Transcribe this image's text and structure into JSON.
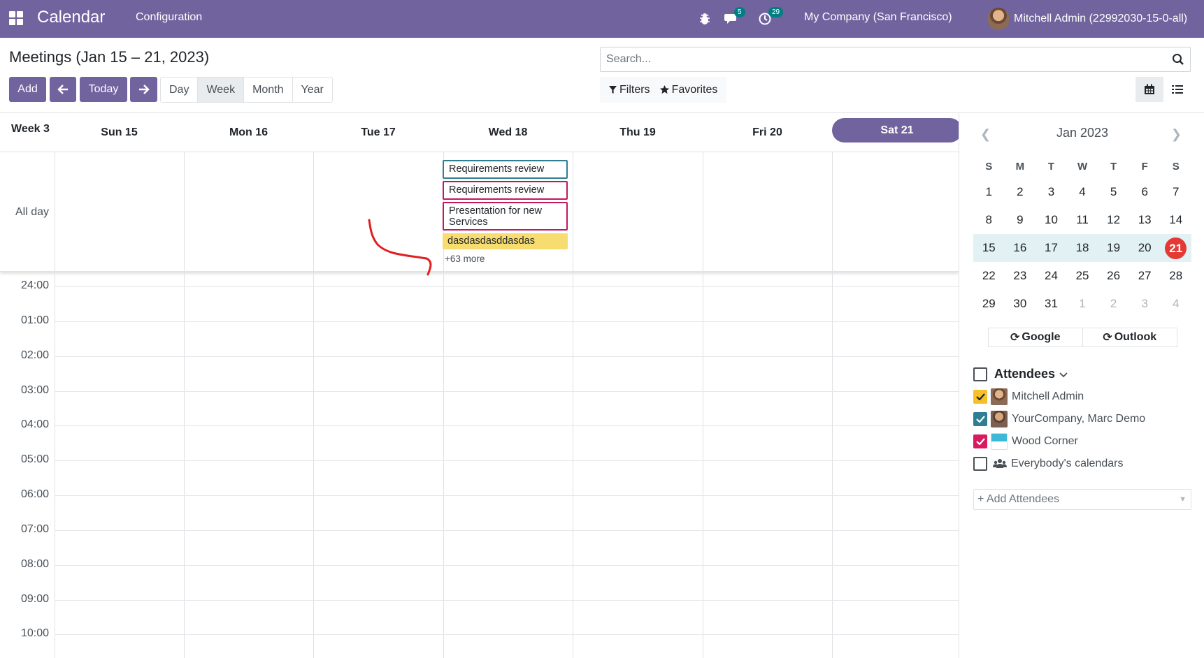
{
  "navbar": {
    "app_title": "Calendar",
    "menu_configuration": "Configuration",
    "chat_badge": "5",
    "activity_badge": "29",
    "company": "My Company (San Francisco)",
    "user": "Mitchell Admin (22992030-15-0-all)"
  },
  "control": {
    "title": "Meetings (Jan 15 – 21, 2023)",
    "add_label": "Add",
    "today_label": "Today",
    "scales": [
      "Day",
      "Week",
      "Month",
      "Year"
    ],
    "active_scale": "Week",
    "search_placeholder": "Search...",
    "filters_label": "Filters",
    "favorites_label": "Favorites"
  },
  "calendar": {
    "week_label": "Week 3",
    "days": [
      "Sun 15",
      "Mon 16",
      "Tue 17",
      "Wed 18",
      "Thu 19",
      "Fri 20",
      "Sat 21"
    ],
    "today_index": 6,
    "all_day_label": "All day",
    "events": [
      {
        "title": "Requirements review",
        "style": "teal"
      },
      {
        "title": "Requirements review",
        "style": "pink"
      },
      {
        "title": "Presentation for new Services",
        "style": "pink"
      },
      {
        "title": "dasdasdasddasdas",
        "style": "yellow"
      }
    ],
    "more_label": "+63 more",
    "hours": [
      "24:00",
      "01:00",
      "02:00",
      "03:00",
      "04:00",
      "05:00",
      "06:00",
      "07:00",
      "08:00",
      "09:00",
      "10:00"
    ]
  },
  "mini_calendar": {
    "title": "Jan 2023",
    "dow": [
      "S",
      "M",
      "T",
      "W",
      "T",
      "F",
      "S"
    ],
    "weeks": [
      [
        "1",
        "2",
        "3",
        "4",
        "5",
        "6",
        "7"
      ],
      [
        "8",
        "9",
        "10",
        "11",
        "12",
        "13",
        "14"
      ],
      [
        "15",
        "16",
        "17",
        "18",
        "19",
        "20",
        "21"
      ],
      [
        "22",
        "23",
        "24",
        "25",
        "26",
        "27",
        "28"
      ],
      [
        "29",
        "30",
        "31",
        "1",
        "2",
        "3",
        "4"
      ]
    ],
    "highlight_week": 2,
    "today": "21"
  },
  "sync": {
    "google": "Google",
    "outlook": "Outlook"
  },
  "attendees": {
    "title": "Attendees",
    "items": [
      {
        "name": "Mitchell Admin",
        "checked": true,
        "color": "#f5c02a"
      },
      {
        "name": "YourCompany, Marc Demo",
        "checked": true,
        "color": "#2f7f92"
      },
      {
        "name": "Wood Corner",
        "checked": true,
        "color": "#d81b60"
      },
      {
        "name": "Everybody's calendars",
        "checked": false,
        "color": ""
      }
    ],
    "add_placeholder": "+ Add Attendees"
  },
  "colors": {
    "brand": "#71639e",
    "today_red": "#e53935"
  }
}
